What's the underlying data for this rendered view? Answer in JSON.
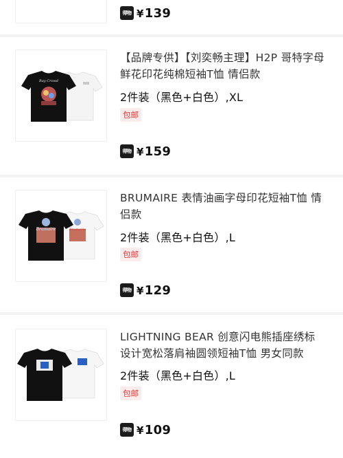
{
  "colors": {
    "accent": "#e23b3b",
    "tag_bg": "#fdecec",
    "page_bg": "#f2f2f2"
  },
  "top_partial": {
    "price": "139"
  },
  "products": [
    {
      "title": "【品牌专供】【刘奕畅主理】H2P 哥特字母鲜花印花纯棉短袖T恤 情侣款",
      "spec": "2件装（黑色+白色）,XL",
      "tag": "包邮",
      "price": "159",
      "thumb_icon": "tshirt-pair-icon"
    },
    {
      "title": "BRUMAIRE 表情油画字母印花短袖T恤 情侣款",
      "spec": "2件装（黑色+白色）,L",
      "tag": "包邮",
      "price": "129",
      "thumb_icon": "tshirt-pair-icon"
    },
    {
      "title": "LIGHTNING BEAR 创意闪电熊插座绣标 设计宽松落肩袖圆领短袖T恤  男女同款",
      "spec": "2件装（黑色+白色）,L",
      "tag": "包邮",
      "price": "109",
      "thumb_icon": "tshirt-pair-icon"
    }
  ],
  "brand_logo_text": "得物",
  "currency_symbol": "¥"
}
